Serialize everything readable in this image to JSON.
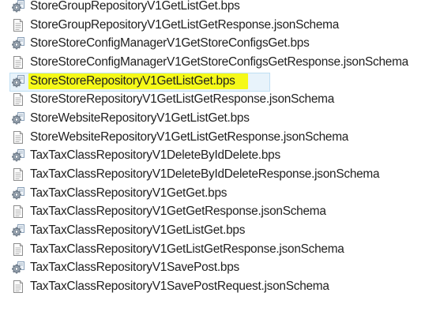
{
  "explorer": {
    "selected_index": 4,
    "highlight_color": "#f5f919",
    "selection_color": "#e8f3fb",
    "files": [
      {
        "name": "StoreGroupRepositoryV1GetListGet.bps",
        "icon": "gear-file-icon"
      },
      {
        "name": "StoreGroupRepositoryV1GetListGetResponse.jsonSchema",
        "icon": "document-icon"
      },
      {
        "name": "StoreStoreConfigManagerV1GetStoreConfigsGet.bps",
        "icon": "gear-file-icon"
      },
      {
        "name": "StoreStoreConfigManagerV1GetStoreConfigsGetResponse.jsonSchema",
        "icon": "document-icon"
      },
      {
        "name": "StoreStoreRepositoryV1GetListGet.bps",
        "icon": "gear-file-icon"
      },
      {
        "name": "StoreStoreRepositoryV1GetListGetResponse.jsonSchema",
        "icon": "document-icon"
      },
      {
        "name": "StoreWebsiteRepositoryV1GetListGet.bps",
        "icon": "gear-file-icon"
      },
      {
        "name": "StoreWebsiteRepositoryV1GetListGetResponse.jsonSchema",
        "icon": "document-icon"
      },
      {
        "name": "TaxTaxClassRepositoryV1DeleteByIdDelete.bps",
        "icon": "gear-file-icon"
      },
      {
        "name": "TaxTaxClassRepositoryV1DeleteByIdDeleteResponse.jsonSchema",
        "icon": "document-icon"
      },
      {
        "name": "TaxTaxClassRepositoryV1GetGet.bps",
        "icon": "gear-file-icon"
      },
      {
        "name": "TaxTaxClassRepositoryV1GetGetResponse.jsonSchema",
        "icon": "document-icon"
      },
      {
        "name": "TaxTaxClassRepositoryV1GetListGet.bps",
        "icon": "gear-file-icon"
      },
      {
        "name": "TaxTaxClassRepositoryV1GetListGetResponse.jsonSchema",
        "icon": "document-icon"
      },
      {
        "name": "TaxTaxClassRepositoryV1SavePost.bps",
        "icon": "gear-file-icon"
      },
      {
        "name": "TaxTaxClassRepositoryV1SavePostRequest.jsonSchema",
        "icon": "document-icon"
      }
    ]
  }
}
